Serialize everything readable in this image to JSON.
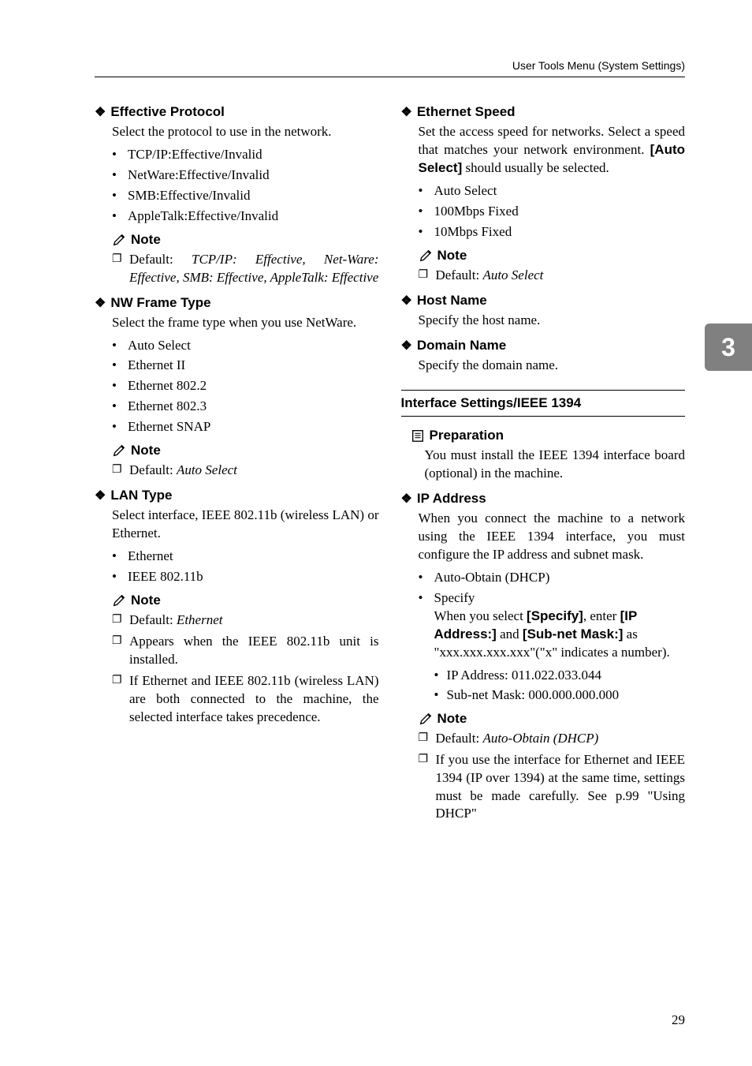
{
  "header": {
    "running": "User Tools Menu (System Settings)"
  },
  "chapter_tab": "3",
  "page_number": "29",
  "left": {
    "effective_protocol": {
      "title": "Effective Protocol",
      "body": "Select the protocol to use in the network.",
      "bullets": [
        "TCP/IP:Effective/Invalid",
        "NetWare:Effective/Invalid",
        "SMB:Effective/Invalid",
        "AppleTalk:Effective/Invalid"
      ],
      "note_label": "Note",
      "note_default_prefix": "Default: ",
      "note_default_value": "TCP/IP: Effective, Net-Ware: Effective, SMB: Effective, AppleTalk: Effective"
    },
    "nw_frame_type": {
      "title": "NW Frame Type",
      "body": "Select the frame type when you use NetWare.",
      "bullets": [
        "Auto Select",
        "Ethernet II",
        "Ethernet 802.2",
        "Ethernet 802.3",
        "Ethernet SNAP"
      ],
      "note_label": "Note",
      "note_default_prefix": "Default: ",
      "note_default_value": "Auto Select"
    },
    "lan_type": {
      "title": "LAN Type",
      "body": "Select interface, IEEE 802.11b (wireless LAN) or Ethernet.",
      "bullets": [
        "Ethernet",
        "IEEE 802.11b"
      ],
      "note_label": "Note",
      "note1_prefix": "Default: ",
      "note1_value": "Ethernet",
      "note2": "Appears when the IEEE 802.11b unit is installed.",
      "note3": "If Ethernet and IEEE 802.11b (wireless LAN) are both connected to the machine, the selected interface takes precedence."
    }
  },
  "right": {
    "ethernet_speed": {
      "title": "Ethernet Speed",
      "body_pre": "Set the access speed for networks. Select a speed that matches your network environment. ",
      "body_bold": "[Auto Select]",
      "body_post": " should usually be selected.",
      "bullets": [
        "Auto Select",
        "100Mbps Fixed",
        "10Mbps Fixed"
      ],
      "note_label": "Note",
      "note_default_prefix": "Default: ",
      "note_default_value": "Auto Select"
    },
    "host_name": {
      "title": "Host Name",
      "body": "Specify the host name."
    },
    "domain_name": {
      "title": "Domain Name",
      "body": "Specify the domain name."
    },
    "section_title": "Interface Settings/IEEE 1394",
    "preparation": {
      "title": "Preparation",
      "body": "You must install the IEEE 1394 interface board (optional) in the machine."
    },
    "ip_address": {
      "title": "IP Address",
      "body": "When you connect the machine to a network using the IEEE 1394 interface, you must configure the IP address and subnet mask.",
      "bullet1": "Auto-Obtain (DHCP)",
      "bullet2_head": "Specify",
      "bullet2_pre": "When you select ",
      "bullet2_b1": "[Specify]",
      "bullet2_mid": ", enter ",
      "bullet2_b2": "[IP Address:]",
      "bullet2_and": " and ",
      "bullet2_b3": "[Sub-net Mask:]",
      "bullet2_post": " as \"xxx.xxx.xxx.xxx\"(\"x\" indicates a number).",
      "sub1": "IP Address: 011.022.033.044",
      "sub2": "Sub-net Mask: 000.000.000.000",
      "note_label": "Note",
      "note1_prefix": "Default: ",
      "note1_value": "Auto-Obtain (DHCP)",
      "note2": "If you use the interface for Ethernet and IEEE 1394 (IP over 1394) at the same time, settings must be made carefully. See p.99 \"Using DHCP\""
    }
  }
}
